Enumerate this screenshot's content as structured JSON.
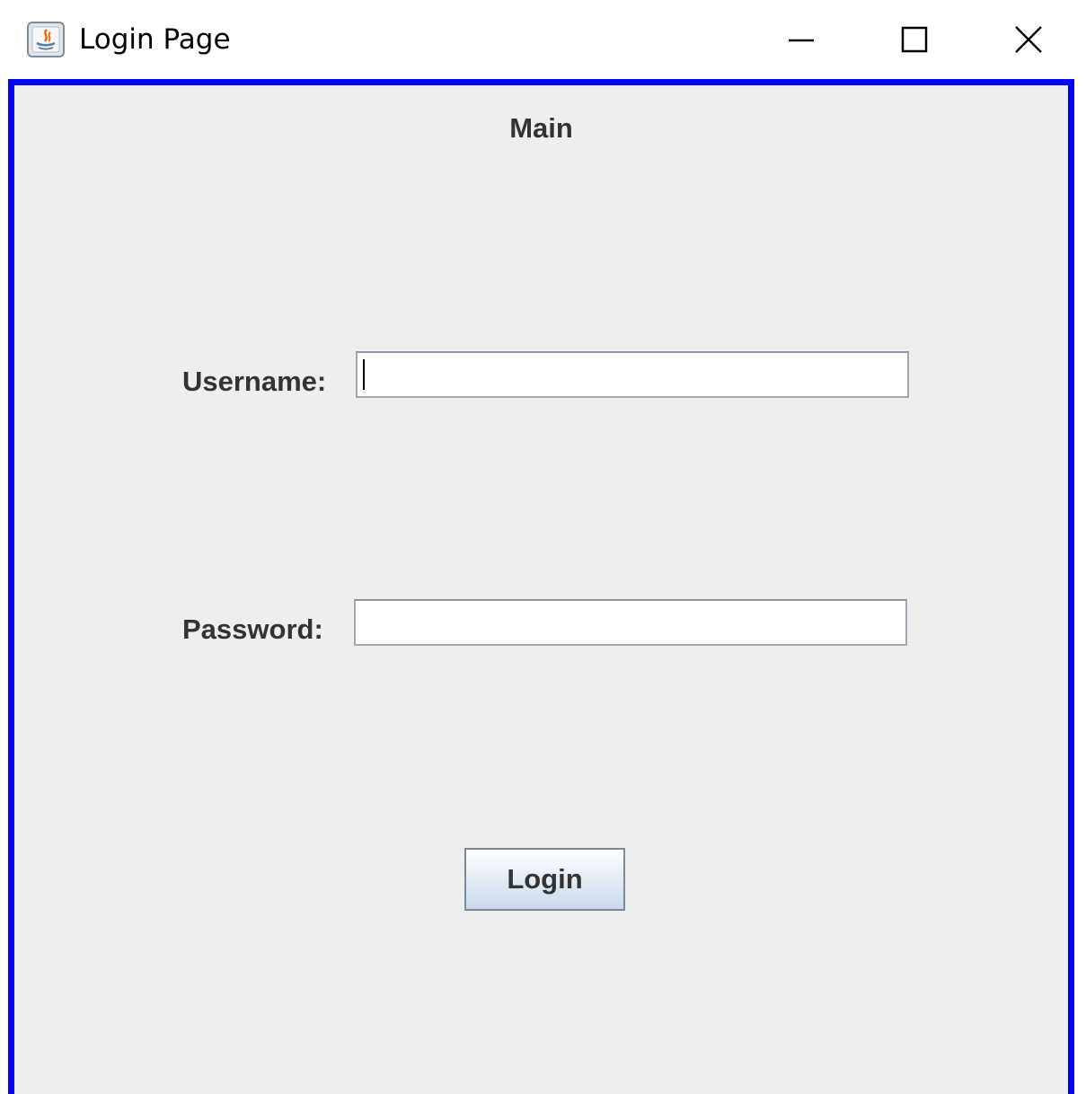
{
  "window": {
    "title": "Login Page",
    "app_icon": "java-icon",
    "controls": {
      "minimize": "minimize-icon",
      "maximize": "maximize-icon",
      "close": "close-icon"
    },
    "border_color": "#0000ff"
  },
  "form": {
    "heading": "Main",
    "username_label": "Username:",
    "username_value": "",
    "password_label": "Password:",
    "password_value": "",
    "login_label": "Login"
  }
}
